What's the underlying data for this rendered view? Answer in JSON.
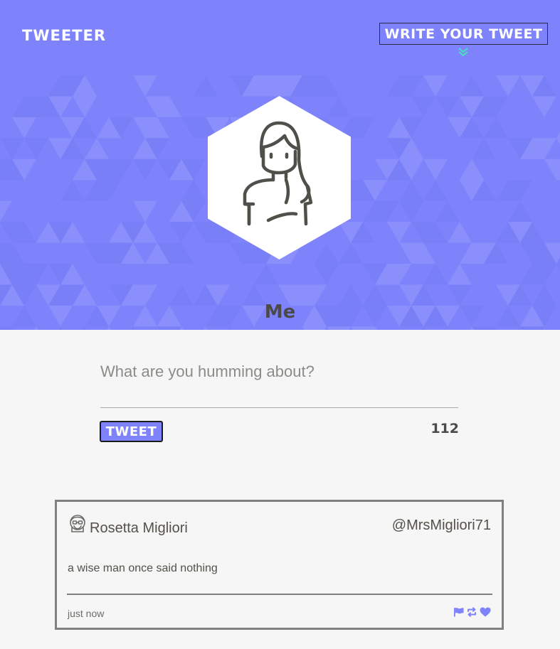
{
  "nav": {
    "brand": "Tweeter",
    "compose_label": "Write your tweet",
    "chevron_icon": "double-chevron-down-icon"
  },
  "profile": {
    "display_name": "Me",
    "avatar_icon": "female-avatar-icon"
  },
  "compose": {
    "placeholder": "What are you humming about?",
    "value": "",
    "submit_label": "Tweet",
    "counter": "112"
  },
  "tweets": [
    {
      "name": "Rosetta Migliori",
      "handle": "@MrsMigliori71",
      "content": "a wise man once said nothing",
      "time": "just now",
      "avatar_icon": "user-avatar-icon",
      "actions": [
        "flag-icon",
        "retweet-icon",
        "heart-icon"
      ]
    }
  ],
  "colors": {
    "accent": "#7e83fc",
    "chevron": "#4fd8c4",
    "page_bg": "#f6f6f6",
    "text": "#545149"
  }
}
